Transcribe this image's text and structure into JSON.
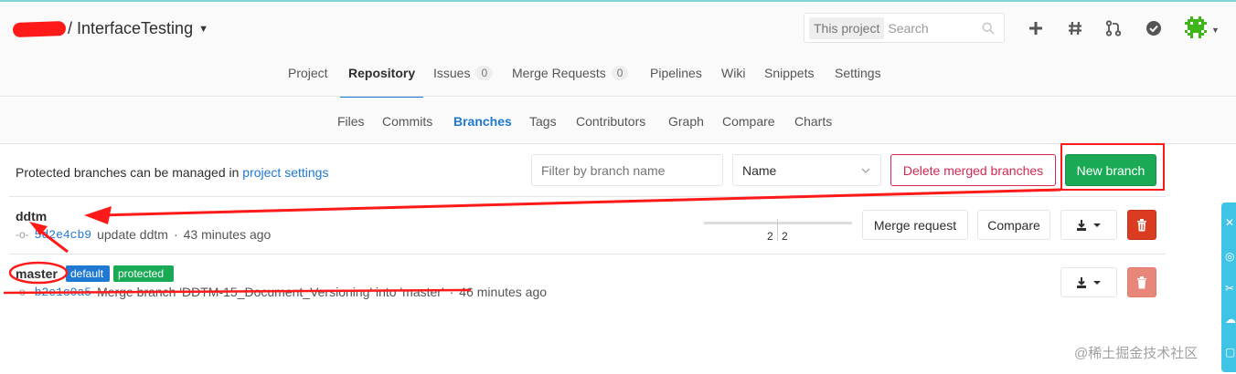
{
  "header": {
    "project_title": "/ InterfaceTesting",
    "search": {
      "scope": "This project",
      "placeholder": "Search"
    }
  },
  "nav": {
    "tabs": [
      {
        "label": "Project"
      },
      {
        "label": "Repository",
        "active": true
      },
      {
        "label": "Issues",
        "count": "0"
      },
      {
        "label": "Merge Requests",
        "count": "0"
      },
      {
        "label": "Pipelines"
      },
      {
        "label": "Wiki"
      },
      {
        "label": "Snippets"
      },
      {
        "label": "Settings"
      }
    ]
  },
  "subnav": {
    "items": [
      {
        "label": "Files"
      },
      {
        "label": "Commits"
      },
      {
        "label": "Branches",
        "active": true
      },
      {
        "label": "Tags"
      },
      {
        "label": "Contributors"
      },
      {
        "label": "Graph"
      },
      {
        "label": "Compare"
      },
      {
        "label": "Charts"
      }
    ]
  },
  "toolbar": {
    "protected_note": "Protected branches can be managed in ",
    "protected_link": "project settings",
    "filter_placeholder": "Filter by branch name",
    "sort_value": "Name",
    "delete_merged_label": "Delete merged branches",
    "new_branch_label": "New branch"
  },
  "branches": [
    {
      "name": "ddtm",
      "sha": "5d2e4cb9",
      "message": "update ddtm",
      "sep": "·",
      "time": "43 minutes ago",
      "behind": "2",
      "ahead": "2",
      "merge_request_label": "Merge request",
      "compare_label": "Compare"
    },
    {
      "name": "master",
      "badges": [
        "default",
        "protected"
      ],
      "sha": "b2e1c0a5",
      "message": "Merge branch 'DDTM-15_Document_Versioning' into 'master'",
      "sep": "·",
      "time": "46 minutes ago"
    }
  ],
  "colors": {
    "accent_blue": "#1f78d1",
    "success_green": "#1aaa55",
    "danger_red": "#db3b21",
    "annotation_red": "#ff1a1a"
  },
  "watermark": "@稀土掘金技术社区"
}
